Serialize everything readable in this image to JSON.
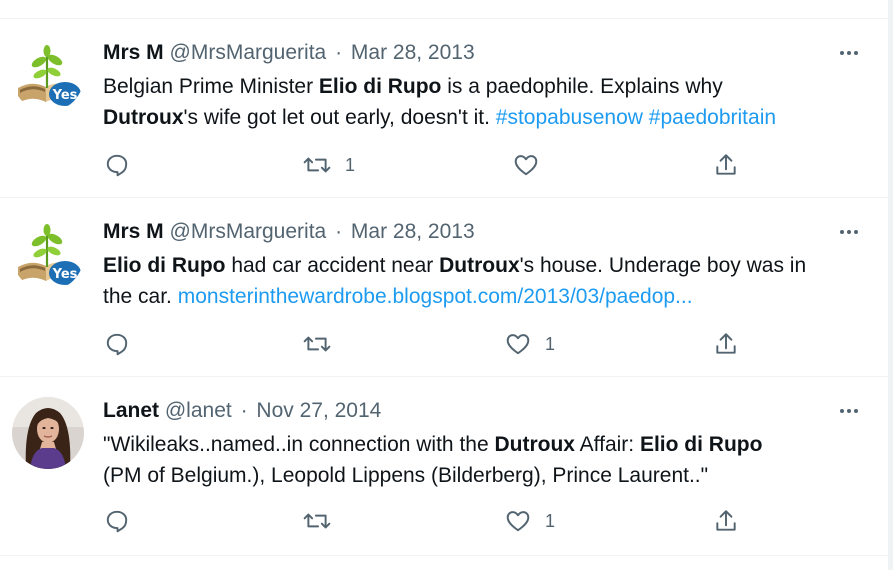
{
  "tweets": [
    {
      "name": "Mrs M",
      "handle": "@MrsMarguerita",
      "date": "Mar 28, 2013",
      "avatar": "yes-sapling-book-avatar",
      "text": {
        "t1": "Belgian Prime Minister ",
        "b1": "Elio di Rupo",
        "t2": " is a paedophile. Explains why",
        "b2": "Dutroux",
        "t3": "'s wife got let out early, doesn't it. ",
        "l1": "#stopabusenow",
        "l2": "#paedobritain"
      },
      "reply_count": "",
      "retweet_count": "1",
      "like_count": ""
    },
    {
      "name": "Mrs M",
      "handle": "@MrsMarguerita",
      "date": "Mar 28, 2013",
      "avatar": "yes-sapling-book-avatar",
      "text": {
        "b1": "Elio di Rupo",
        "t1": " had car accident near ",
        "b2": "Dutroux",
        "t2": "'s house. Underage boy was in",
        "t3": "the car. ",
        "l1": "monsterinthewardrobe.blogspot.com/2013/03/paedop..."
      },
      "reply_count": "",
      "retweet_count": "",
      "like_count": "1"
    },
    {
      "name": "Lanet",
      "handle": "@lanet",
      "date": "Nov 27, 2014",
      "avatar": "woman-photo-avatar",
      "text": {
        "t1": "\"Wikileaks..named..in connection with the ",
        "b1": "Dutroux",
        "t2": " Affair: ",
        "b2": "Elio di Rupo",
        "t3": "(PM of Belgium.), Leopold Lippens (Bilderberg), Prince Laurent..\""
      },
      "reply_count": "",
      "retweet_count": "",
      "like_count": "1"
    }
  ],
  "icons": [
    "reply-icon",
    "retweet-icon",
    "like-icon",
    "share-icon",
    "more-icon"
  ],
  "colors": {
    "link": "#1d9bf0",
    "secondary_text": "#536471",
    "divider": "#eff3f4",
    "yes_badge": "#1c6fb5",
    "sapling": "#7cbf2b"
  }
}
